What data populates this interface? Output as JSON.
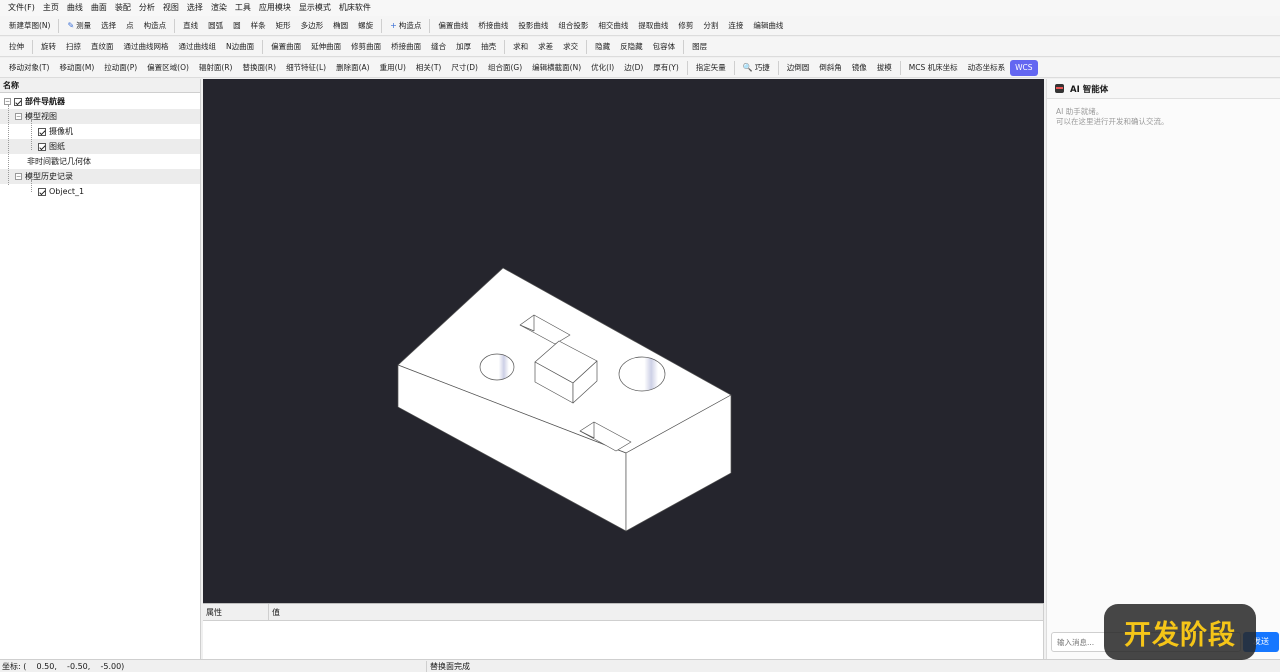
{
  "menu": [
    "文件(F)",
    "主页",
    "曲线",
    "曲面",
    "装配",
    "分析",
    "视图",
    "选择",
    "渲染",
    "工具",
    "应用模块",
    "显示模式",
    "机床软件"
  ],
  "toolbar1": {
    "new_sketch": "新建草图(N)",
    "measure": "测量",
    "select": "选择",
    "point": "点",
    "construct_point": "构造点",
    "line": "直线",
    "arc": "圆弧",
    "circle": "圆",
    "spline": "样条",
    "rect": "矩形",
    "polygon": "多边形",
    "ellipse": "椭圆",
    "helix": "螺旋",
    "construct_point2": "构造点",
    "offset_curve": "偏置曲线",
    "bridge_curve": "桥接曲线",
    "project_curve": "投影曲线",
    "combine_project": "组合投影",
    "intersect_curve": "相交曲线",
    "extract_curve": "提取曲线",
    "trim": "修剪",
    "split": "分割",
    "join": "连接",
    "edit_curve": "编辑曲线"
  },
  "toolbar2": {
    "extrude": "拉伸",
    "revolve": "旋转",
    "sweep": "扫掠",
    "ruled": "直纹面",
    "through_mesh": "通过曲线网格",
    "through_group": "通过曲线组",
    "n_sided": "N边曲面",
    "offset_surface": "偏置曲面",
    "extend_surface": "延伸曲面",
    "trim_surface": "修剪曲面",
    "bridge_surface": "桥接曲面",
    "sew": "缝合",
    "thicken": "加厚",
    "shell": "抽壳",
    "unite": "求和",
    "subtract": "求差",
    "intersect": "求交",
    "hide": "隐藏",
    "unhide": "反隐藏",
    "bbox": "包容体",
    "layer": "图层"
  },
  "toolbar3": {
    "move_object": "移动对象(T)",
    "move_face": "移动面(M)",
    "pull_face": "拉动面(P)",
    "offset_region": "偏置区域(O)",
    "fillet_face": "辐射面(R)",
    "replace_face": "替换面(R)",
    "detail_feature": "细节特征(L)",
    "delete_face": "删除面(A)",
    "reuse": "重用(U)",
    "relate": "相关(T)",
    "dimension": "尺寸(D)",
    "group_face": "组合面(G)",
    "edit_section": "编辑横截面(N)",
    "optimize": "优化(I)",
    "edge": "边(D)",
    "thickness": "厚有(Y)",
    "specify_vector": "指定矢量",
    "snap": "巧捷",
    "edge_fillet": "边倒圆",
    "chamfer": "倒斜角",
    "mirror": "镜像",
    "draft": "拔模",
    "mcs": "MCS 机床坐标",
    "dynamic_cs": "动态坐标系",
    "wcs": "WCS"
  },
  "navigator": {
    "header": "名称",
    "root": "部件导航器",
    "model_views": "模型视图",
    "camera": "摄像机",
    "drawing": "图纸",
    "non_timestamp": "非时间戳记几何体",
    "model_history": "模型历史记录",
    "object1": "Object_1"
  },
  "properties": {
    "col_name": "属性",
    "col_value": "值"
  },
  "ai": {
    "title": "AI 智能体",
    "line1": "AI 助手就绪。",
    "line2": "可以在这里进行开发和确认交流。",
    "input_placeholder": "输入消息...",
    "send": "发送"
  },
  "status": {
    "coord": "坐标: (    0.50,    -0.50,    -5.00)",
    "message": "替换面完成"
  },
  "watermark": "开发阶段",
  "colors": {
    "viewport_bg": "#25252d",
    "accent": "#6366f1",
    "send_button": "#1677ff"
  }
}
